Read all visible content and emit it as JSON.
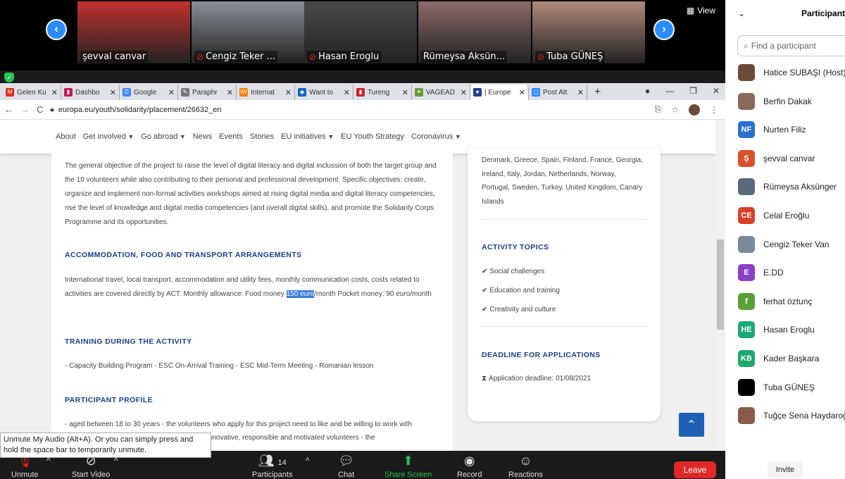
{
  "video_strip": {
    "view_label": "View",
    "tiles": [
      {
        "name": "şevval canvar",
        "muted": false,
        "color": "#c2322e"
      },
      {
        "name": "Cengiz Teker ...",
        "muted": true,
        "color": "#8a8f96"
      },
      {
        "name": "Hasan Eroglu",
        "muted": true,
        "color": "#4a4a4a"
      },
      {
        "name": "Rümeysa Aksün...",
        "muted": false,
        "color": "#8c6a6a"
      },
      {
        "name": "Tuba GÜNEŞ",
        "muted": true,
        "color": "#b08a7a"
      }
    ]
  },
  "browser": {
    "tabs": [
      {
        "title": "Gelen Ku",
        "fav_color": "#d93025",
        "fav": "M"
      },
      {
        "title": "Dashbo",
        "fav_color": "#c2185b",
        "fav": "▮"
      },
      {
        "title": "Google",
        "fav_color": "#4285f4",
        "fav": "D"
      },
      {
        "title": "Paraphr",
        "fav_color": "#777777",
        "fav": "✎"
      },
      {
        "title": "Internat",
        "fav_color": "#f57c00",
        "fav": "IW"
      },
      {
        "title": "Want to",
        "fav_color": "#1565c0",
        "fav": "◆"
      },
      {
        "title": "Tureng",
        "fav_color": "#c62828",
        "fav": "▮"
      },
      {
        "title": "VAGEAD",
        "fav_color": "#6a9a3a",
        "fav": "✦"
      },
      {
        "title": "| Europe",
        "fav_color": "#1d3e8a",
        "fav": "★",
        "active": true
      },
      {
        "title": "Post Att",
        "fav_color": "#2d8cff",
        "fav": "▢"
      }
    ],
    "url": "europa.eu/youth/solidarity/placement/26632_en"
  },
  "site_nav": [
    "About",
    "Get involved",
    "Go abroad",
    "News",
    "Events",
    "Stories",
    "EU initiatives",
    "EU Youth Strategy",
    "Coronavirus"
  ],
  "main": {
    "objective": "The general objective of the project to raise the level of digital literacy and digital inclussion of both the target group and the 10 volunteers while also contributing to their personal and professional development. Specific objectives: create, organize and implement non-formal activities workshops aimed at rising digital media and digital literacy competencies, rise the level of knowledge and digital media competencies (and overall digital skills), and promote the Solidarity Corps Programme and its opportunities.",
    "accommodation_heading": "ACCOMMODATION, FOOD AND TRANSPORT ARRANGEMENTS",
    "accommodation_pre": "International travel, local transport, accommodation and utility fees, monthly communication costs, costs related to activities are covered directly by ACT. Monthly allowance: Food money ",
    "accommodation_highlight": "150 euro",
    "accommodation_post": "/month Pocket money: 90 euro/month",
    "training_heading": "TRAINING DURING THE ACTIVITY",
    "training_text": "- Capacity Building Program - ESC On-Arrival Training - ESC Mid-Term Meeting - Romanian lesson",
    "profile_heading": "PARTICIPANT PROFILE",
    "profile_text": "- aged between 18 to 30 years - the volunteers who apply for this project need to like and be willing to work with",
    "profile_text2": "creative, innovative, responsible and motivated volunteers - the"
  },
  "side": {
    "countries": "Denmark, Greece, Spain, Finland, France, Georgia, Ireland, Italy, Jordan, Netherlands, Norway, Portugal, Sweden, Turkey, United Kingdom, Canary Islands",
    "topics_heading": "ACTIVITY TOPICS",
    "topics": [
      "Social challenges",
      "Education and training",
      "Creativity and culture"
    ],
    "deadline_heading": "DEADLINE FOR APPLICATIONS",
    "deadline_text": "Application deadline: 01/08/2021"
  },
  "tooltip": "Unmute My Audio (Alt+A). Or you can simply press and hold the space bar to temporarily unmute.",
  "toolbar": {
    "unmute": "Unmute",
    "start_video": "Start Video",
    "participants": "Participants",
    "participants_count": "14",
    "chat": "Chat",
    "share_screen": "Share Screen",
    "record": "Record",
    "reactions": "Reactions",
    "leave": "Leave"
  },
  "participants_panel": {
    "title": "Participants",
    "search_placeholder": "Find a participant",
    "invite": "Invite",
    "list": [
      {
        "name": "Hatice SUBAŞI (Host)",
        "initials": "",
        "color": "#6b4a3a"
      },
      {
        "name": "Berfin Dakak",
        "initials": "",
        "color": "#8a6a5a"
      },
      {
        "name": "Nurten Filiz",
        "initials": "NF",
        "color": "#2a6fd1"
      },
      {
        "name": "şevval canvar",
        "initials": "Ş",
        "color": "#d9502a"
      },
      {
        "name": "Rümeysa Aksünger",
        "initials": "",
        "color": "#5a6a7a"
      },
      {
        "name": "Celal Eroğlu",
        "initials": "CE",
        "color": "#d9412a"
      },
      {
        "name": "Cengiz Teker Van",
        "initials": "",
        "color": "#7a8a9a"
      },
      {
        "name": "E.DD",
        "initials": "E",
        "color": "#8a3ec7"
      },
      {
        "name": "ferhat öztunç",
        "initials": "f",
        "color": "#5aa03a"
      },
      {
        "name": "Hasan Eroglu",
        "initials": "HE",
        "color": "#1da87a"
      },
      {
        "name": "Kader Başkara",
        "initials": "KB",
        "color": "#1da86a"
      },
      {
        "name": "Tuba GÜNEŞ",
        "initials": "",
        "color": "#000000"
      },
      {
        "name": "Tuğçe Sena Haydaroğlu",
        "initials": "",
        "color": "#8a5a4a"
      }
    ]
  }
}
